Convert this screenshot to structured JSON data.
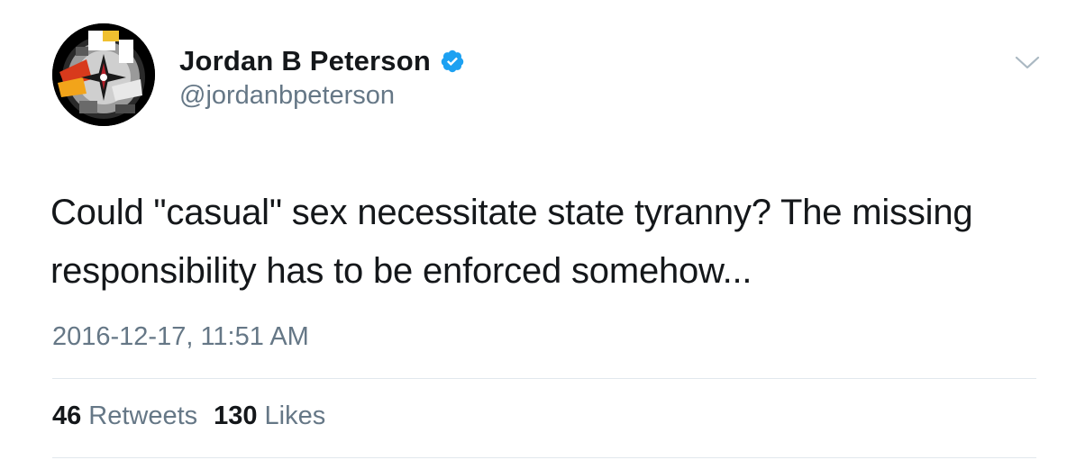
{
  "colors": {
    "primary_text": "#14171a",
    "secondary_text": "#657786",
    "verified_blue": "#1da1f2",
    "divider": "#e1e8ed"
  },
  "author": {
    "display_name": "Jordan B Peterson",
    "handle": "@jordanbpeterson",
    "verified": true,
    "avatar_icon": "avatar-image"
  },
  "tweet": {
    "text": "Could \"casual\" sex necessitate state tyranny? The missing responsibility has to be enforced somehow...",
    "timestamp": "2016-12-17, 11:51 AM"
  },
  "stats": {
    "retweets_count": "46",
    "retweets_label": "Retweets",
    "likes_count": "130",
    "likes_label": "Likes"
  },
  "icons": {
    "verified": "verified-badge-icon",
    "menu": "chevron-down-icon"
  }
}
